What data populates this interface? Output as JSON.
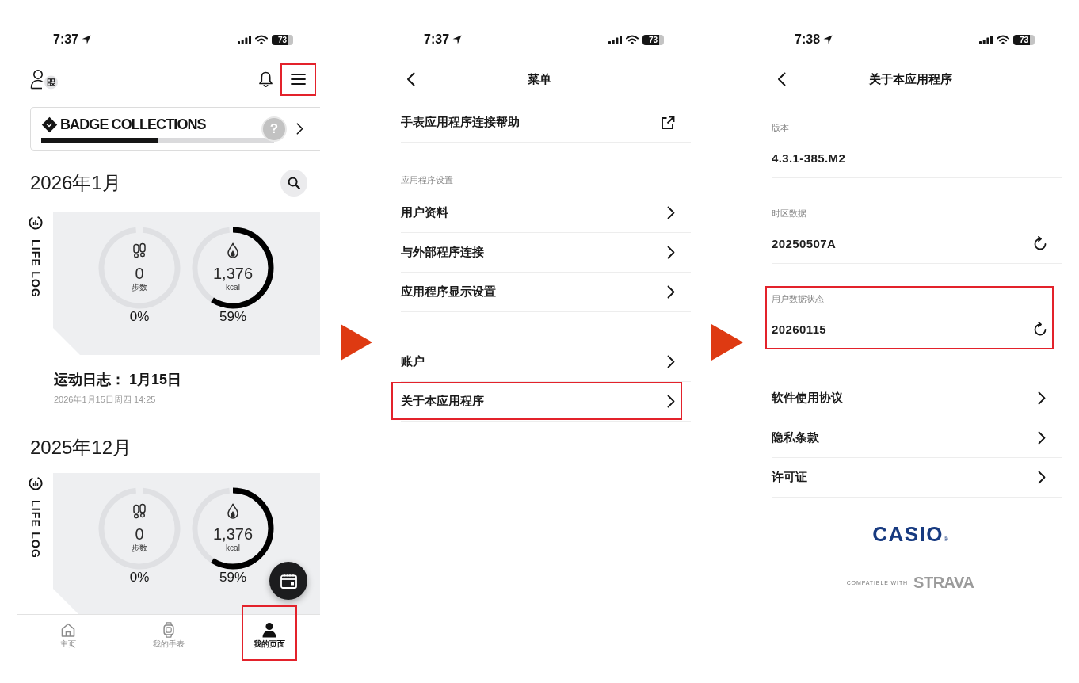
{
  "screens": [
    {
      "kind": "my_page",
      "status_bar": {
        "time": "7:37",
        "battery": "73"
      },
      "header": {
        "menu_highlighted": true
      },
      "badge_collections": {
        "title": "BADGE COLLECTIONS",
        "level": 0.5,
        "next_badge": "?"
      },
      "months": [
        {
          "title": "2026年1月",
          "search_button": true,
          "life_log": {
            "label": "LIFE LOG",
            "rings": [
              {
                "kind": "steps",
                "value": "0",
                "unit": "步数",
                "percent": "0%",
                "level": 0
              },
              {
                "kind": "calories",
                "value": "1,376",
                "unit": "kcal",
                "percent": "59%",
                "level": 0.59
              }
            ]
          },
          "entry": {
            "title": "运动日志： 1月15日",
            "subtitle": "2026年1月15日周四 14:25"
          }
        },
        {
          "title": "2025年12月",
          "search_button": false,
          "life_log": {
            "label": "LIFE LOG",
            "rings": [
              {
                "kind": "steps",
                "value": "0",
                "unit": "步数",
                "percent": "0%",
                "level": 0
              },
              {
                "kind": "calories",
                "value": "1,376",
                "unit": "kcal",
                "percent": "59%",
                "level": 0.59
              }
            ]
          }
        }
      ],
      "tab_bar": [
        {
          "kind": "home",
          "label": "主页",
          "selected": false,
          "highlighted": false
        },
        {
          "kind": "watch",
          "label": "我的手表",
          "selected": false,
          "highlighted": false
        },
        {
          "kind": "profile",
          "label": "我的页面",
          "selected": true,
          "highlighted": true
        }
      ]
    },
    {
      "kind": "menu",
      "status_bar": {
        "time": "7:37",
        "battery": "73"
      },
      "title": "菜单",
      "sections": [
        {
          "items": [
            {
              "kind": "external",
              "label": "手表应用程序连接帮助",
              "highlighted": false
            }
          ]
        },
        {
          "heading": "应用程序设置",
          "items": [
            {
              "kind": "chevron",
              "label": "用户资料",
              "highlighted": false
            },
            {
              "kind": "chevron",
              "label": "与外部程序连接",
              "highlighted": false
            },
            {
              "kind": "chevron",
              "label": "应用程序显示设置",
              "highlighted": false
            }
          ]
        },
        {
          "items": [
            {
              "kind": "chevron",
              "label": "账户",
              "highlighted": false
            },
            {
              "kind": "chevron",
              "label": "关于本应用程序",
              "highlighted": true
            }
          ]
        }
      ]
    },
    {
      "kind": "about",
      "status_bar": {
        "time": "7:38",
        "battery": "73"
      },
      "title": "关于本应用程序",
      "info": [
        {
          "label": "版本",
          "value": "4.3.1-385.M2",
          "refresh": false,
          "highlighted": false
        },
        {
          "label": "时区数据",
          "value": "20250507A",
          "refresh": true,
          "highlighted": false
        },
        {
          "label": "用户数据状态",
          "value": "20260115",
          "refresh": true,
          "highlighted": true
        }
      ],
      "links": [
        {
          "label": "软件使用协议"
        },
        {
          "label": "隐私条款"
        },
        {
          "label": "许可证"
        }
      ],
      "logo": "CASIO$_{®}$",
      "compatible": {
        "prefix": "COMPATIBLE WITH",
        "brand": "STRAVA"
      }
    }
  ]
}
